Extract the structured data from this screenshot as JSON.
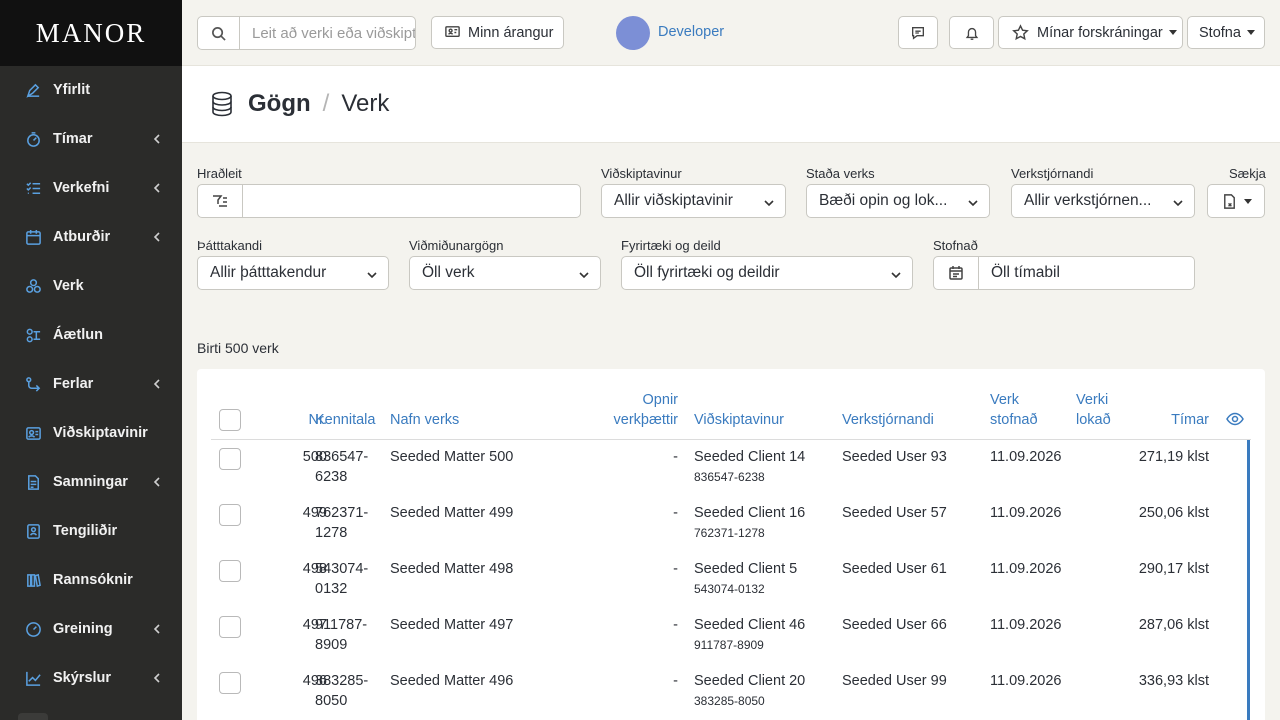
{
  "brand": "MANOR",
  "sidebar": {
    "items": [
      {
        "label": "Yfirlit",
        "icon": "pen-chart-icon",
        "submenu": false
      },
      {
        "label": "Tímar",
        "icon": "timer-icon",
        "submenu": true
      },
      {
        "label": "Verkefni",
        "icon": "list-check-icon",
        "submenu": true
      },
      {
        "label": "Atburðir",
        "icon": "calendar-icon",
        "submenu": true
      },
      {
        "label": "Verk",
        "icon": "cubes-icon",
        "submenu": false
      },
      {
        "label": "Áætlun",
        "icon": "people-plan-icon",
        "submenu": false
      },
      {
        "label": "Ferlar",
        "icon": "flow-arrow-icon",
        "submenu": true
      },
      {
        "label": "Viðskiptavinir",
        "icon": "id-card-icon",
        "submenu": false
      },
      {
        "label": "Samningar",
        "icon": "contract-icon",
        "submenu": true
      },
      {
        "label": "Tengiliðir",
        "icon": "contact-book-icon",
        "submenu": false
      },
      {
        "label": "Rannsóknir",
        "icon": "books-icon",
        "submenu": false
      },
      {
        "label": "Greining",
        "icon": "gauge-icon",
        "submenu": true
      },
      {
        "label": "Skýrslur",
        "icon": "line-chart-icon",
        "submenu": true
      }
    ]
  },
  "topbar": {
    "search_placeholder": "Leit að verki eða viðskiptavini",
    "achievement_label": "Minn árangur",
    "user_name": "Developer",
    "favorites_label": "Mínar forskráningar",
    "create_label": "Stofna"
  },
  "page": {
    "title_section": "Gögn",
    "title_page": "Verk"
  },
  "filters": {
    "quick_search_label": "Hraðleit",
    "quick_search_value": "",
    "client_label": "Viðskiptavinur",
    "client_value": "Allir viðskiptavinir",
    "status_label": "Staða verks",
    "status_value": "Bæði opin og lok...",
    "manager_label": "Verkstjórnandi",
    "manager_value": "Allir verkstjórnen...",
    "fetch_label": "Sækja",
    "participant_label": "Þátttakandi",
    "participant_value": "Allir þátttakendur",
    "reference_label": "Viðmiðunargögn",
    "reference_value": "Öll verk",
    "company_label": "Fyrirtæki og deild",
    "company_value": "Öll fyrirtæki og deildir",
    "created_label": "Stofnað",
    "created_value": "Öll tímabil"
  },
  "result_count": "Birti 500 verk",
  "table": {
    "headers": {
      "nr": "Nr.",
      "kennitala": "Kennitala",
      "name": "Nafn verks",
      "open_tasks_1": "Opnir",
      "open_tasks_2": "verkþættir",
      "client": "Viðskiptavinur",
      "manager": "Verkstjórnandi",
      "created_1": "Verk",
      "created_2": "stofnað",
      "closed_1": "Verki",
      "closed_2": "lokað",
      "hours": "Tímar"
    },
    "rows": [
      {
        "nr": "500",
        "kt1": "836547-",
        "kt2": "6238",
        "name": "Seeded Matter 500",
        "open": "-",
        "client": "Seeded Client 14",
        "client_kt": "836547-6238",
        "manager": "Seeded User 93",
        "created": "11.09.2026",
        "closed": "",
        "hours": "271,19 klst"
      },
      {
        "nr": "499",
        "kt1": "762371-",
        "kt2": "1278",
        "name": "Seeded Matter 499",
        "open": "-",
        "client": "Seeded Client 16",
        "client_kt": "762371-1278",
        "manager": "Seeded User 57",
        "created": "11.09.2026",
        "closed": "",
        "hours": "250,06 klst"
      },
      {
        "nr": "498",
        "kt1": "543074-",
        "kt2": "0132",
        "name": "Seeded Matter 498",
        "open": "-",
        "client": "Seeded Client 5",
        "client_kt": "543074-0132",
        "manager": "Seeded User 61",
        "created": "11.09.2026",
        "closed": "",
        "hours": "290,17 klst"
      },
      {
        "nr": "497",
        "kt1": "911787-",
        "kt2": "8909",
        "name": "Seeded Matter 497",
        "open": "-",
        "client": "Seeded Client 46",
        "client_kt": "911787-8909",
        "manager": "Seeded User 66",
        "created": "11.09.2026",
        "closed": "",
        "hours": "287,06 klst"
      },
      {
        "nr": "496",
        "kt1": "383285-",
        "kt2": "8050",
        "name": "Seeded Matter 496",
        "open": "-",
        "client": "Seeded Client 20",
        "client_kt": "383285-8050",
        "manager": "Seeded User 99",
        "created": "11.09.2026",
        "closed": "",
        "hours": "336,93 klst"
      }
    ]
  }
}
